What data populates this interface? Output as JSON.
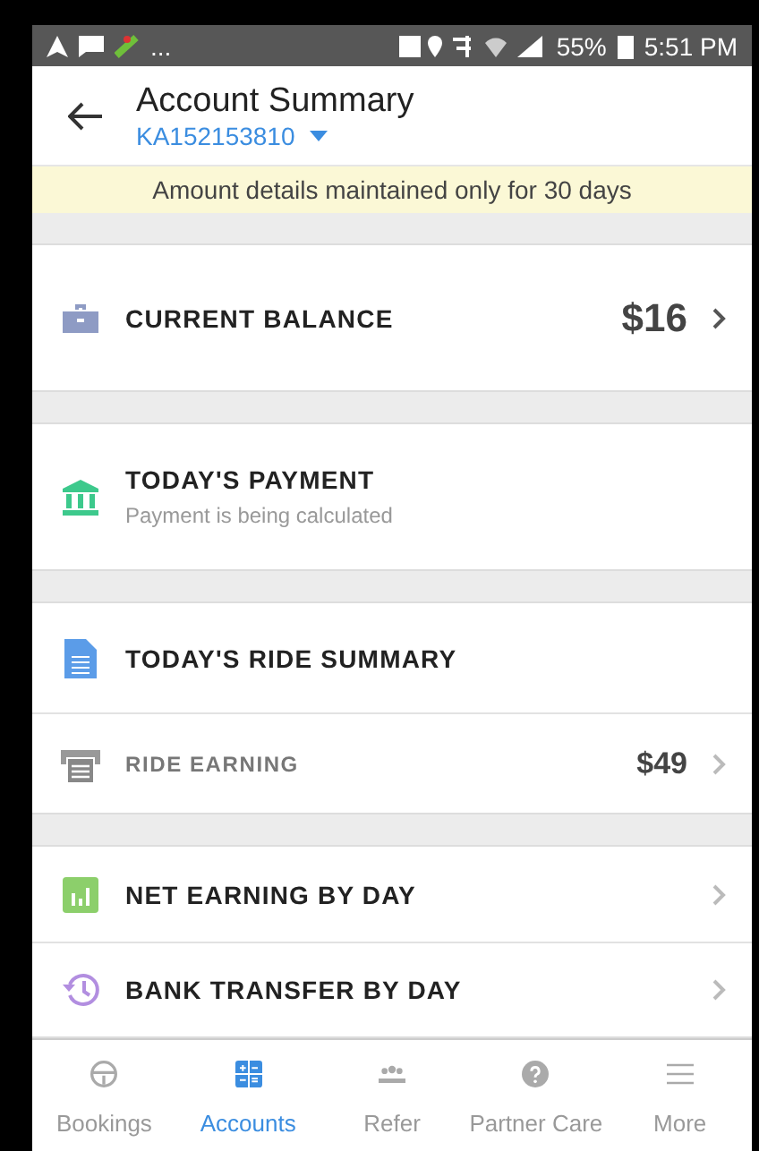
{
  "status_bar": {
    "overflow": "...",
    "battery": "55%",
    "time": "5:51 PM"
  },
  "header": {
    "title": "Account Summary",
    "account": "KA152153810"
  },
  "notice": "Amount details maintained only for 30 days",
  "groups": [
    {
      "rows": [
        {
          "kind": "main",
          "title": "CURRENT BALANCE",
          "amount": "$16",
          "chevron": true
        }
      ]
    },
    {
      "rows": [
        {
          "kind": "main",
          "title": "TODAY'S PAYMENT",
          "subtitle": "Payment is being calculated",
          "chevron": false
        }
      ]
    },
    {
      "rows": [
        {
          "kind": "main",
          "title": "TODAY'S RIDE SUMMARY",
          "chevron": false
        },
        {
          "kind": "detail",
          "title": "RIDE EARNING",
          "amount": "$49",
          "chevron": true
        }
      ]
    },
    {
      "rows": [
        {
          "kind": "main",
          "title": "NET EARNING BY DAY",
          "chevron": true
        },
        {
          "kind": "main",
          "title": "BANK TRANSFER BY DAY",
          "chevron": true
        }
      ]
    }
  ],
  "tabs": [
    {
      "label": "Bookings",
      "selected": false
    },
    {
      "label": "Accounts",
      "selected": true
    },
    {
      "label": "Refer",
      "selected": false
    },
    {
      "label": "Partner Care",
      "selected": false
    },
    {
      "label": "More",
      "selected": false
    }
  ]
}
